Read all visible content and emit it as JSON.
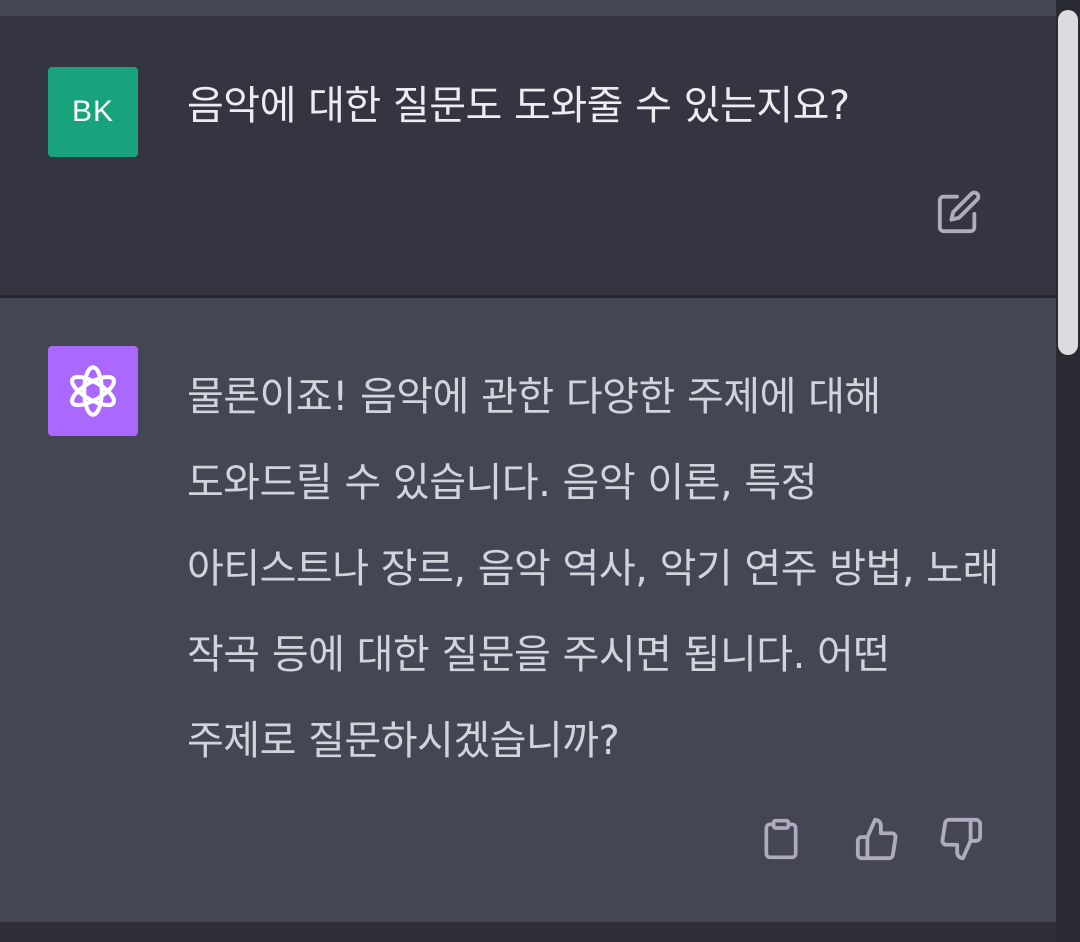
{
  "conversation": {
    "user_message": {
      "avatar_initials": "BK",
      "avatar_color": "#19a37c",
      "text": "음악에 대한 질문도 도와줄 수 있는지요?",
      "edit_icon": "edit-icon"
    },
    "assistant_message": {
      "avatar_icon": "openai-logo-icon",
      "avatar_color": "#ab68ff",
      "text": "물론이죠! 음악에 관한 다양한 주제에 대해 도와드릴 수 있습니다. 음악 이론, 특정 아티스트나 장르, 음악 역사, 악기 연주 방법, 노래 작곡 등에 대한 질문을 주시면 됩니다. 어떤 주제로 질문하시겠습니까?",
      "actions": [
        "copy-icon",
        "thumbs-up-icon",
        "thumbs-down-icon"
      ]
    }
  }
}
